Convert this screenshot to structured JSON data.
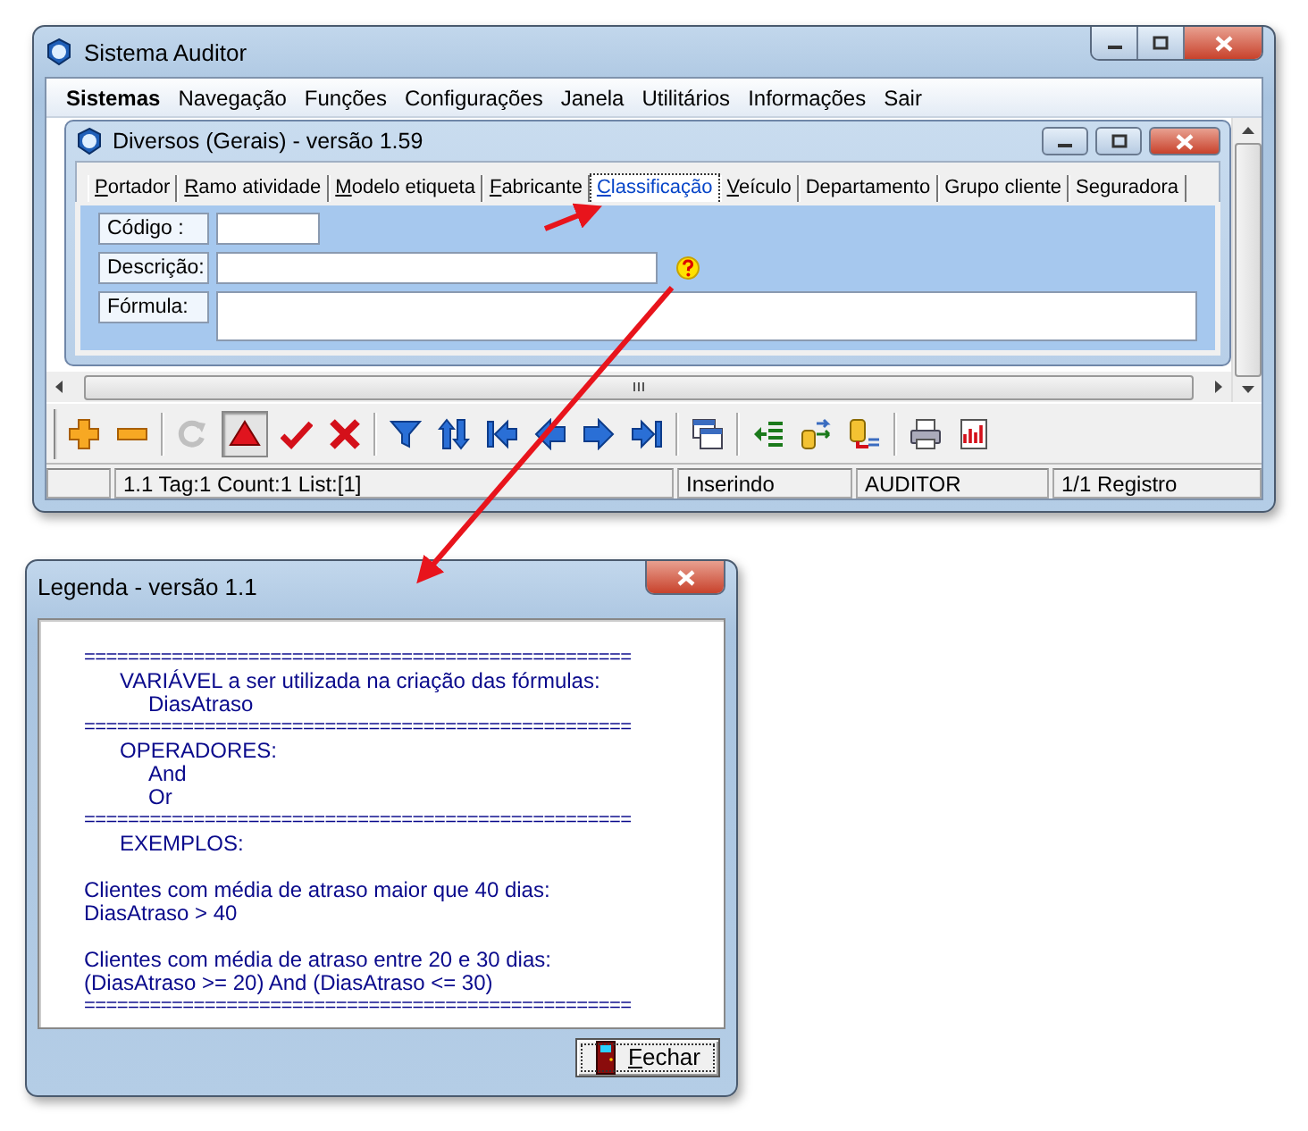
{
  "main_window": {
    "title": "Sistema Auditor",
    "menu": [
      {
        "label": "Sistemas",
        "selected": true
      },
      {
        "label": "Navegação",
        "selected": false
      },
      {
        "label": "Funções",
        "selected": false
      },
      {
        "label": "Configurações",
        "selected": false
      },
      {
        "label": "Janela",
        "selected": false
      },
      {
        "label": "Utilitários",
        "selected": false
      },
      {
        "label": "Informações",
        "selected": false
      },
      {
        "label": "Sair",
        "selected": false
      }
    ],
    "child_window": {
      "title": "Diversos (Gerais) - versão 1.59",
      "tabs": [
        {
          "label": "Portador",
          "selected": false,
          "access_key": true
        },
        {
          "label": "Ramo atividade",
          "selected": false,
          "access_key": true
        },
        {
          "label": "Modelo etiqueta",
          "selected": false,
          "access_key": true
        },
        {
          "label": "Fabricante",
          "selected": false,
          "access_key": true
        },
        {
          "label": "Classificação",
          "selected": true,
          "access_key": true
        },
        {
          "label": "Veículo",
          "selected": false,
          "access_key": true
        },
        {
          "label": "Departamento",
          "selected": false,
          "access_key": false
        },
        {
          "label": "Grupo cliente",
          "selected": false,
          "access_key": false
        },
        {
          "label": "Seguradora",
          "selected": false,
          "access_key": false
        }
      ],
      "fields": [
        {
          "label": "Código :",
          "kind": "short"
        },
        {
          "label": "Descrição:",
          "kind": "medium",
          "help": true
        },
        {
          "label": "Fórmula:",
          "kind": "memo"
        }
      ]
    },
    "toolbar": [
      [
        {
          "kind": "add",
          "disabled": false,
          "pressed": false
        },
        {
          "kind": "remove",
          "disabled": false,
          "pressed": false
        }
      ],
      [
        {
          "kind": "refresh",
          "disabled": true,
          "pressed": false
        },
        {
          "kind": "up",
          "disabled": false,
          "pressed": true
        },
        {
          "kind": "confirm",
          "disabled": false,
          "pressed": false
        },
        {
          "kind": "cancel",
          "disabled": false,
          "pressed": false
        }
      ],
      [
        {
          "kind": "filter",
          "disabled": false,
          "pressed": false
        },
        {
          "kind": "sort",
          "disabled": false,
          "pressed": false
        },
        {
          "kind": "first",
          "disabled": false,
          "pressed": false
        },
        {
          "kind": "previous",
          "disabled": false,
          "pressed": false
        },
        {
          "kind": "next",
          "disabled": false,
          "pressed": false
        },
        {
          "kind": "last",
          "disabled": false,
          "pressed": false
        }
      ],
      [
        {
          "kind": "window",
          "disabled": false,
          "pressed": false
        }
      ],
      [
        {
          "kind": "import",
          "disabled": false,
          "pressed": false
        },
        {
          "kind": "export",
          "disabled": false,
          "pressed": false
        },
        {
          "kind": "link",
          "disabled": false,
          "pressed": false
        }
      ],
      [
        {
          "kind": "print",
          "disabled": false,
          "pressed": false
        },
        {
          "kind": "report",
          "disabled": false,
          "pressed": false
        }
      ]
    ],
    "status_bar": [
      "1.1 Tag:1 Count:1 List:[1]",
      "Inserindo",
      "AUDITOR",
      "1/1 Registro"
    ]
  },
  "legend_window": {
    "title": "Legenda - versão 1.1",
    "lines": [
      {
        "kind": "rule",
        "text": "=================================================="
      },
      {
        "kind": "heading",
        "text": "VARIÁVEL a ser utilizada na criação das fórmulas:"
      },
      {
        "kind": "item",
        "text": "DiasAtraso"
      },
      {
        "kind": "rule",
        "text": "=================================================="
      },
      {
        "kind": "heading",
        "text": "OPERADORES:"
      },
      {
        "kind": "item",
        "text": "And"
      },
      {
        "kind": "item",
        "text": "Or"
      },
      {
        "kind": "rule",
        "text": "=================================================="
      },
      {
        "kind": "heading",
        "text": "EXEMPLOS:"
      },
      {
        "kind": "gap"
      },
      {
        "kind": "text",
        "text": "Clientes com média de atraso maior que 40 dias:"
      },
      {
        "kind": "text",
        "text": "DiasAtraso > 40"
      },
      {
        "kind": "gap"
      },
      {
        "kind": "text",
        "text": "Clientes com média de atraso entre 20 e 30 dias:"
      },
      {
        "kind": "text",
        "text": "(DiasAtraso >= 20) And (DiasAtraso <= 30)"
      },
      {
        "kind": "rule",
        "text": "=================================================="
      }
    ],
    "close_button": {
      "label": "Fechar",
      "access_key": true
    }
  }
}
